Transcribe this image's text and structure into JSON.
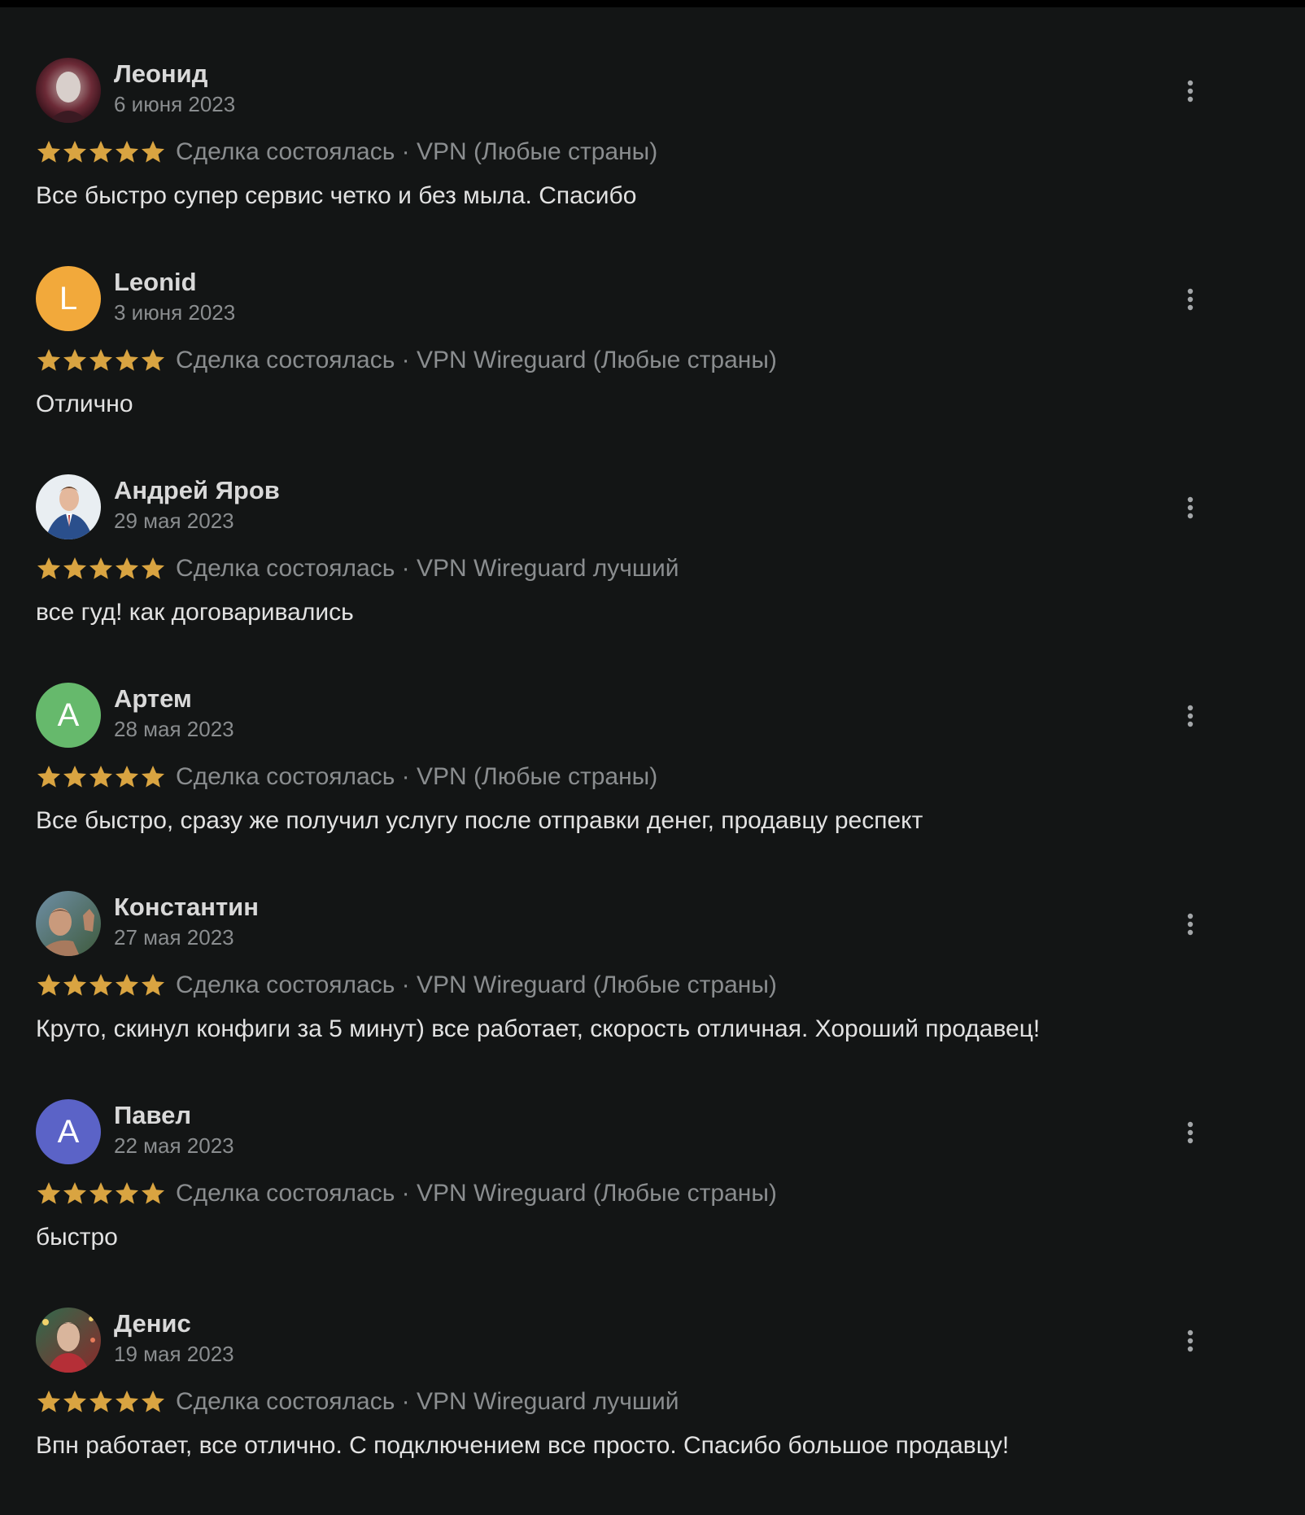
{
  "colors": {
    "background": "#131515",
    "star": "#d9a441",
    "muted_text": "#8a8d8f",
    "name_text": "#d9d9d9",
    "body_text": "#e2e2e2"
  },
  "reviews": [
    {
      "author": "Леонид",
      "date": "6 июня 2023",
      "avatar": {
        "type": "photo",
        "icon": "user-photo-avatar"
      },
      "rating": 5,
      "meta": "Сделка состоялась · VPN (Любые страны)",
      "text": "Все быстро супер сервис четко и без мыла. Спасибо"
    },
    {
      "author": "Leonid",
      "date": "3 июня 2023",
      "avatar": {
        "type": "letter",
        "letter": "L",
        "color": "#f2a93b"
      },
      "rating": 5,
      "meta": "Сделка состоялась · VPN Wireguard (Любые страны)",
      "text": "Отлично"
    },
    {
      "author": "Андрей Яров",
      "date": "29 мая 2023",
      "avatar": {
        "type": "photo",
        "icon": "user-photo-avatar"
      },
      "rating": 5,
      "meta": "Сделка состоялась · VPN Wireguard лучший",
      "text": "все гуд! как договаривались"
    },
    {
      "author": "Артем",
      "date": "28 мая 2023",
      "avatar": {
        "type": "letter",
        "letter": "А",
        "color": "#66b96c"
      },
      "rating": 5,
      "meta": "Сделка состоялась · VPN (Любые страны)",
      "text": "Все быстро, сразу же получил услугу после отправки денег, продавцу респект"
    },
    {
      "author": "Константин",
      "date": "27 мая 2023",
      "avatar": {
        "type": "photo",
        "icon": "user-photo-avatar"
      },
      "rating": 5,
      "meta": "Сделка состоялась · VPN Wireguard (Любые страны)",
      "text": "Круто, скинул конфиги за 5 минут) все работает, скорость отличная. Хороший продавец!"
    },
    {
      "author": "Павел",
      "date": "22 мая 2023",
      "avatar": {
        "type": "letter",
        "letter": "А",
        "color": "#5b63c7"
      },
      "rating": 5,
      "meta": "Сделка состоялась · VPN Wireguard (Любые страны)",
      "text": "быстро"
    },
    {
      "author": "Денис",
      "date": "19 мая 2023",
      "avatar": {
        "type": "photo",
        "icon": "user-photo-avatar"
      },
      "rating": 5,
      "meta": "Сделка состоялась · VPN Wireguard лучший",
      "text": "Впн работает, все отлично. С подключением все просто. Спасибо большое продавцу!"
    }
  ]
}
